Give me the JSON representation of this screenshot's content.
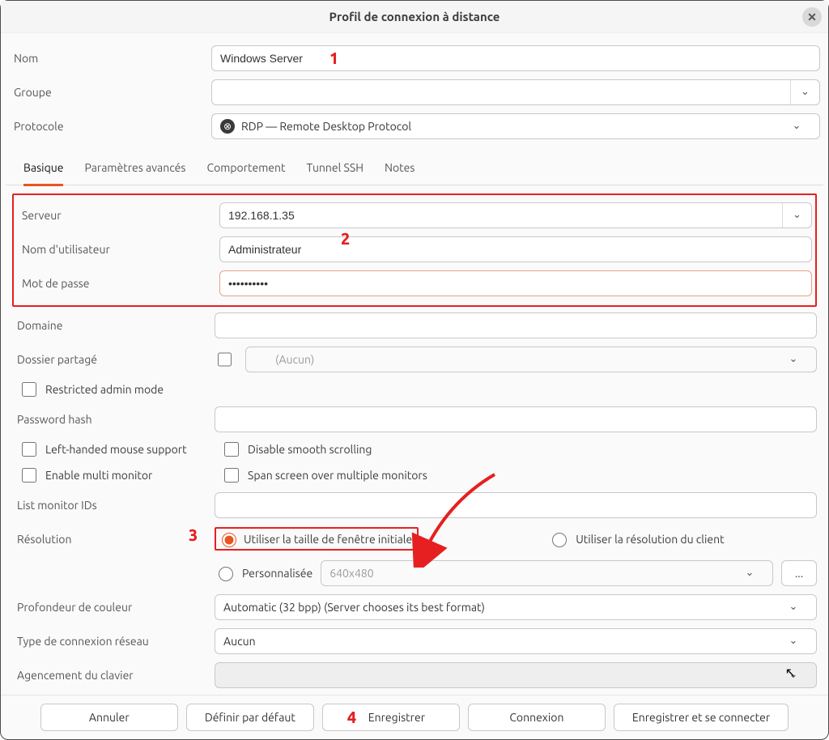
{
  "title": "Profil de connexion à distance",
  "labels": {
    "name": "Nom",
    "group": "Groupe",
    "protocol": "Protocole",
    "server": "Serveur",
    "username": "Nom d'utilisateur",
    "password": "Mot de passe",
    "domain": "Domaine",
    "shared_folder": "Dossier partagé",
    "restricted_admin": "Restricted admin mode",
    "password_hash": "Password hash",
    "left_handed": "Left-handed mouse support",
    "disable_smooth": "Disable smooth scrolling",
    "enable_multi": "Enable multi monitor",
    "span_monitors": "Span screen over multiple monitors",
    "monitor_ids": "List monitor IDs",
    "resolution": "Résolution",
    "res_initial": "Utiliser la taille de fenêtre initiale",
    "res_client": "Utiliser la résolution du client",
    "res_custom": "Personnalisée",
    "color_depth": "Profondeur de couleur",
    "net_type": "Type de connexion réseau",
    "kb_layout": "Agencement du clavier"
  },
  "values": {
    "name": "Windows Server",
    "group": "",
    "protocol": "RDP — Remote Desktop Protocol",
    "server": "192.168.1.35",
    "username": "Administrateur",
    "password": "••••••••••",
    "domain": "",
    "shared_folder_placeholder": "(Aucun)",
    "password_hash": "",
    "monitor_ids": "",
    "res_custom_value": "640x480",
    "color_depth": "Automatic (32 bpp) (Server chooses its best format)",
    "net_type": "Aucun",
    "kb_layout": ""
  },
  "tabs": [
    "Basique",
    "Paramètres avancés",
    "Comportement",
    "Tunnel SSH",
    "Notes"
  ],
  "buttons": {
    "cancel": "Annuler",
    "set_default": "Définir par défaut",
    "save": "Enregistrer",
    "connect": "Connexion",
    "save_connect": "Enregistrer et se connecter",
    "dots": "..."
  },
  "callouts": {
    "c1": "1",
    "c2": "2",
    "c3": "3",
    "c4": "4"
  }
}
